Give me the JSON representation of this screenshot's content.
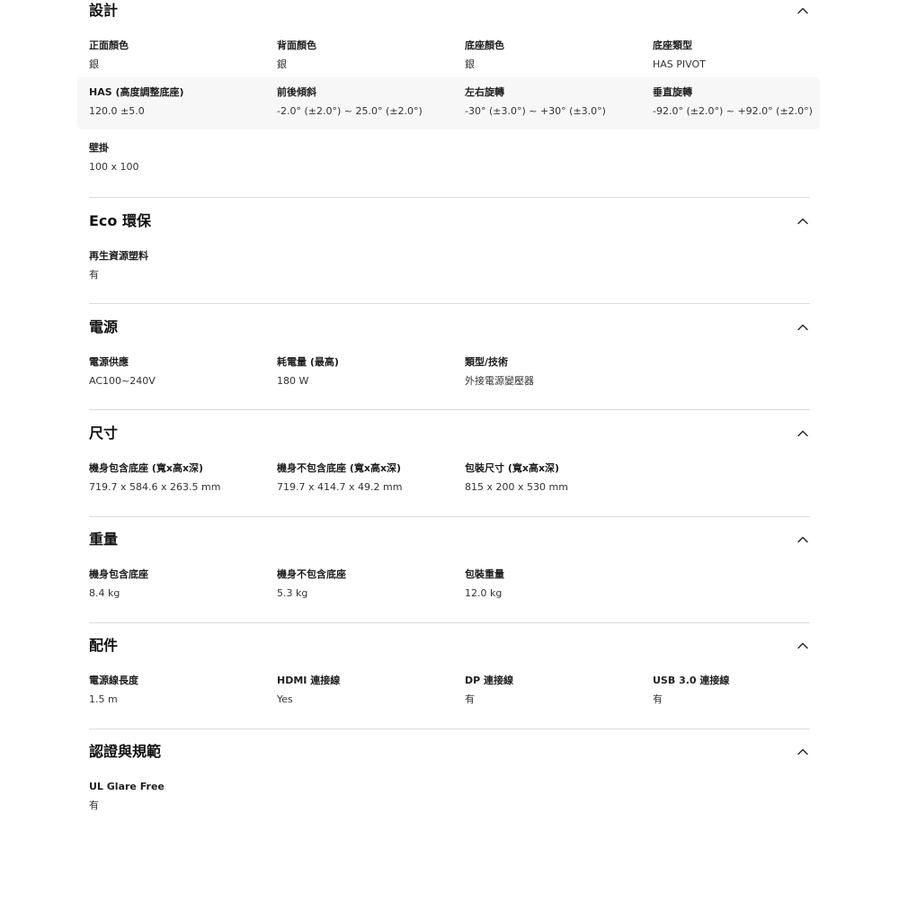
{
  "sections": [
    {
      "title": "設計",
      "rows": [
        [
          {
            "label": "正面顏色",
            "value": "銀"
          },
          {
            "label": "背面顏色",
            "value": "銀"
          },
          {
            "label": "底座顏色",
            "value": "銀"
          },
          {
            "label": "底座類型",
            "value": "HAS PIVOT"
          }
        ],
        [
          {
            "label": "HAS (高度調整底座)",
            "value": "120.0 ±5.0"
          },
          {
            "label": "前後傾斜",
            "value": "-2.0° (±2.0°) ~ 25.0° (±2.0°)"
          },
          {
            "label": "左右旋轉",
            "value": "-30° (±3.0°) ~ +30° (±3.0°)"
          },
          {
            "label": "垂直旋轉",
            "value": "-92.0° (±2.0°) ~ +92.0° (±2.0°)"
          }
        ],
        [
          {
            "label": "壁掛",
            "value": "100 x 100"
          }
        ]
      ]
    },
    {
      "title": "Eco 環保",
      "rows": [
        [
          {
            "label": "再生資源塑料",
            "value": "有"
          }
        ]
      ]
    },
    {
      "title": "電源",
      "rows": [
        [
          {
            "label": "電源供應",
            "value": "AC100~240V"
          },
          {
            "label": "耗電量 (最高)",
            "value": "180 W"
          },
          {
            "label": "類型/技術",
            "value": "外接電源變壓器"
          }
        ]
      ]
    },
    {
      "title": "尺寸",
      "rows": [
        [
          {
            "label": "機身包含底座 (寬x高x深)",
            "value": "719.7 x 584.6 x 263.5 mm"
          },
          {
            "label": "機身不包含底座 (寬x高x深)",
            "value": "719.7 x 414.7 x 49.2 mm"
          },
          {
            "label": "包裝尺寸 (寬x高x深)",
            "value": "815 x 200 x 530 mm"
          }
        ]
      ]
    },
    {
      "title": "重量",
      "rows": [
        [
          {
            "label": "機身包含底座",
            "value": "8.4 kg"
          },
          {
            "label": "機身不包含底座",
            "value": "5.3 kg"
          },
          {
            "label": "包裝重量",
            "value": "12.0 kg"
          }
        ]
      ]
    },
    {
      "title": "配件",
      "rows": [
        [
          {
            "label": "電源線長度",
            "value": "1.5 m"
          },
          {
            "label": "HDMI 連接線",
            "value": "Yes"
          },
          {
            "label": "DP 連接線",
            "value": "有"
          },
          {
            "label": "USB 3.0 連接線",
            "value": "有"
          }
        ]
      ]
    },
    {
      "title": "認證與規範",
      "rows": [
        [
          {
            "label": "UL Glare Free",
            "value": "有"
          }
        ]
      ]
    }
  ],
  "icons": {
    "collapse": "chevron-up-icon"
  },
  "colors": {
    "row_highlight": "#f7f7f7",
    "divider": "#dcdcdc",
    "text": "#1f1f1f"
  }
}
